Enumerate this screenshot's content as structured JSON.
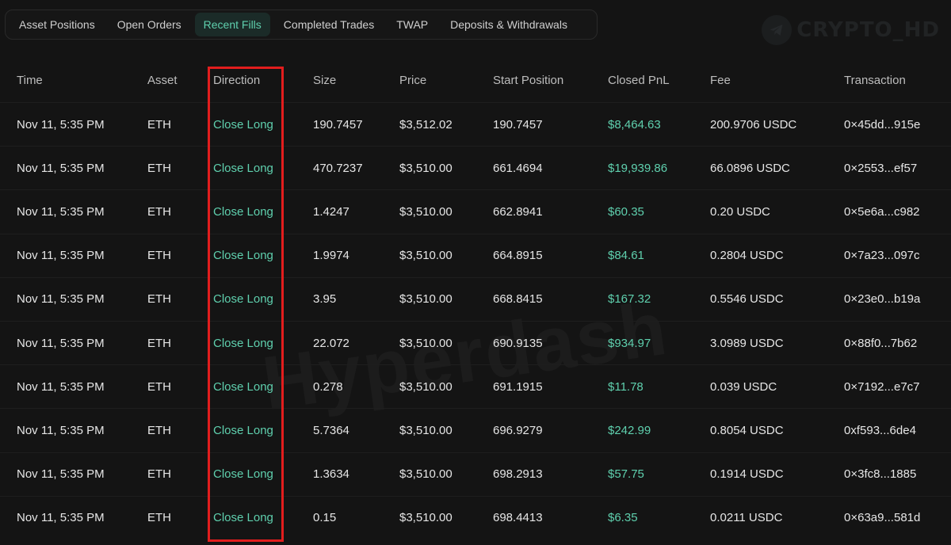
{
  "tabs": [
    {
      "label": "Asset Positions",
      "active": false
    },
    {
      "label": "Open Orders",
      "active": false
    },
    {
      "label": "Recent Fills",
      "active": true
    },
    {
      "label": "Completed Trades",
      "active": false
    },
    {
      "label": "TWAP",
      "active": false
    },
    {
      "label": "Deposits & Withdrawals",
      "active": false
    }
  ],
  "brand": {
    "text": "CRYPTO_HD",
    "icon": "telegram-icon"
  },
  "watermark": "Hyperdash",
  "colors": {
    "accent": "#5fd0ae",
    "highlight": "#e21d1d",
    "background": "#141414"
  },
  "table": {
    "headers": {
      "time": "Time",
      "asset": "Asset",
      "direction": "Direction",
      "size": "Size",
      "price": "Price",
      "start": "Start Position",
      "pnl": "Closed PnL",
      "fee": "Fee",
      "tx": "Transaction"
    },
    "rows": [
      {
        "time": "Nov 11, 5:35 PM",
        "asset": "ETH",
        "direction": "Close Long",
        "size": "190.7457",
        "price": "$3,512.02",
        "start": "190.7457",
        "pnl": "$8,464.63",
        "fee": "200.9706 USDC",
        "tx": "0×45dd...915e"
      },
      {
        "time": "Nov 11, 5:35 PM",
        "asset": "ETH",
        "direction": "Close Long",
        "size": "470.7237",
        "price": "$3,510.00",
        "start": "661.4694",
        "pnl": "$19,939.86",
        "fee": "66.0896 USDC",
        "tx": "0×2553...ef57"
      },
      {
        "time": "Nov 11, 5:35 PM",
        "asset": "ETH",
        "direction": "Close Long",
        "size": "1.4247",
        "price": "$3,510.00",
        "start": "662.8941",
        "pnl": "$60.35",
        "fee": "0.20 USDC",
        "tx": "0×5e6a...c982"
      },
      {
        "time": "Nov 11, 5:35 PM",
        "asset": "ETH",
        "direction": "Close Long",
        "size": "1.9974",
        "price": "$3,510.00",
        "start": "664.8915",
        "pnl": "$84.61",
        "fee": "0.2804 USDC",
        "tx": "0×7a23...097c"
      },
      {
        "time": "Nov 11, 5:35 PM",
        "asset": "ETH",
        "direction": "Close Long",
        "size": "3.95",
        "price": "$3,510.00",
        "start": "668.8415",
        "pnl": "$167.32",
        "fee": "0.5546 USDC",
        "tx": "0×23e0...b19a"
      },
      {
        "time": "Nov 11, 5:35 PM",
        "asset": "ETH",
        "direction": "Close Long",
        "size": "22.072",
        "price": "$3,510.00",
        "start": "690.9135",
        "pnl": "$934.97",
        "fee": "3.0989 USDC",
        "tx": "0×88f0...7b62"
      },
      {
        "time": "Nov 11, 5:35 PM",
        "asset": "ETH",
        "direction": "Close Long",
        "size": "0.278",
        "price": "$3,510.00",
        "start": "691.1915",
        "pnl": "$11.78",
        "fee": "0.039 USDC",
        "tx": "0×7192...e7c7"
      },
      {
        "time": "Nov 11, 5:35 PM",
        "asset": "ETH",
        "direction": "Close Long",
        "size": "5.7364",
        "price": "$3,510.00",
        "start": "696.9279",
        "pnl": "$242.99",
        "fee": "0.8054 USDC",
        "tx": "0xf593...6de4"
      },
      {
        "time": "Nov 11, 5:35 PM",
        "asset": "ETH",
        "direction": "Close Long",
        "size": "1.3634",
        "price": "$3,510.00",
        "start": "698.2913",
        "pnl": "$57.75",
        "fee": "0.1914 USDC",
        "tx": "0×3fc8...1885"
      },
      {
        "time": "Nov 11, 5:35 PM",
        "asset": "ETH",
        "direction": "Close Long",
        "size": "0.15",
        "price": "$3,510.00",
        "start": "698.4413",
        "pnl": "$6.35",
        "fee": "0.0211 USDC",
        "tx": "0×63a9...581d"
      }
    ]
  }
}
